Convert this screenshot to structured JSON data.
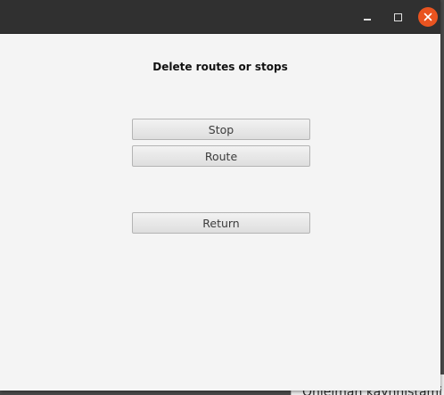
{
  "window": {
    "heading": "Delete routes or stops",
    "buttons": {
      "stop": "Stop",
      "route": "Route",
      "return": "Return"
    },
    "controls": {
      "minimize_icon": "minimize-icon",
      "maximize_icon": "maximize-icon",
      "close_icon": "close-icon",
      "close_color": "#e95420"
    }
  },
  "background_window": {
    "text": "Ohjelman käynnistämi"
  }
}
